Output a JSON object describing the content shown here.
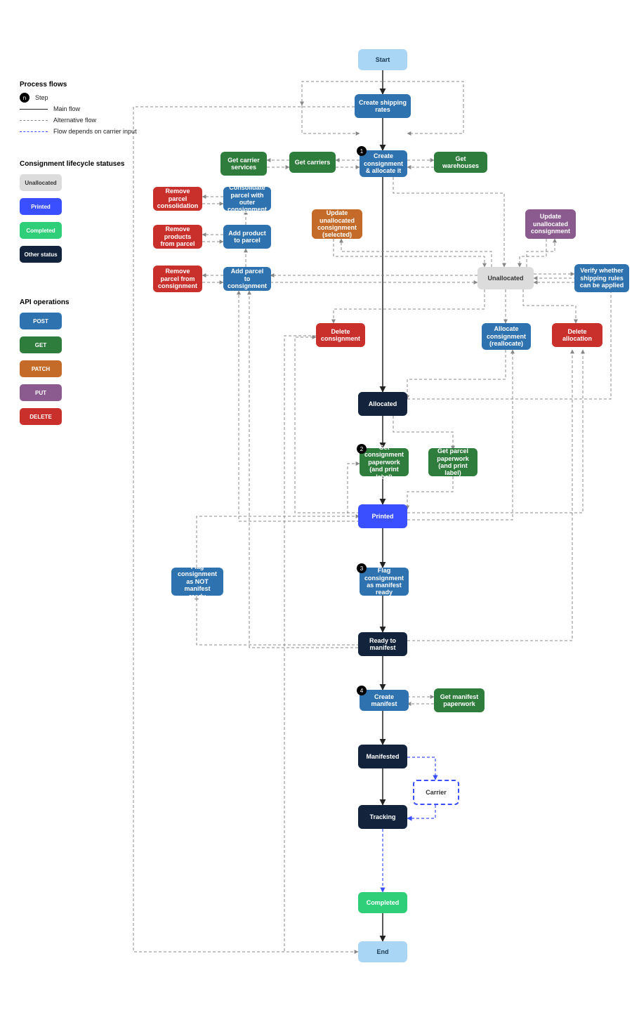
{
  "legend": {
    "processFlowsTitle": "Process flows",
    "stepLabel": "Step",
    "stepBadge": "n",
    "mainFlow": "Main flow",
    "altFlow": "Alternative flow",
    "carrierFlow": "Flow depends on carrier input",
    "lifecycleTitle": "Consignment lifecycle statuses",
    "statusUnallocated": "Unallocated",
    "statusPrinted": "Printed",
    "statusCompleted": "Completed",
    "statusOther": "Other status",
    "apiTitle": "API operations",
    "apiPost": "POST",
    "apiGet": "GET",
    "apiPatch": "PATCH",
    "apiPut": "PUT",
    "apiDelete": "DELETE"
  },
  "steps": {
    "s1": "1",
    "s2": "2",
    "s3": "3",
    "s4": "4"
  },
  "nodes": {
    "start": "Start",
    "createShippingRates": "Create shipping rates",
    "getCarrierServices": "Get carrier services",
    "getCarriers": "Get carriers",
    "createConsignment": "Create consignment & allocate it",
    "getWarehouses": "Get warehouses",
    "consolidateParcel": "Consolidate parcel with outer consignment",
    "removeParcelConsolidation": "Remove parcel consolidation",
    "addProductToParcel": "Add product to parcel",
    "removeProductsFromParcel": "Remove products from parcel",
    "addParcelToConsignment": "Add parcel to consignment",
    "removeParcelFromConsignment": "Remove parcel from consignment",
    "updateUnallocatedSelected": "Update unallocated consignment (selected)",
    "updateUnallocated": "Update unallocated consignment",
    "unallocated": "Unallocated",
    "verifyShippingRules": "Verify whether shipping rules can be applied",
    "deleteConsignment": "Delete consignment",
    "allocateReallocate": "Allocate consignment (reallocate)",
    "deleteAllocation": "Delete allocation",
    "allocated": "Allocated",
    "getConsignmentPaperwork": "Get consignment paperwork (and print label)",
    "getParcelPaperwork": "Get parcel paperwork (and print label)",
    "printed": "Printed",
    "flagNotManifestReady": "Flag consignment as NOT manifest ready",
    "flagManifestReady": "Flag consignment as manifest ready",
    "readyToManifest": "Ready to manifest",
    "createManifest": "Create manifest",
    "getManifestPaperwork": "Get manifest paperwork",
    "manifested": "Manifested",
    "carrier": "Carrier",
    "tracking": "Tracking",
    "completed": "Completed",
    "end": "End"
  }
}
